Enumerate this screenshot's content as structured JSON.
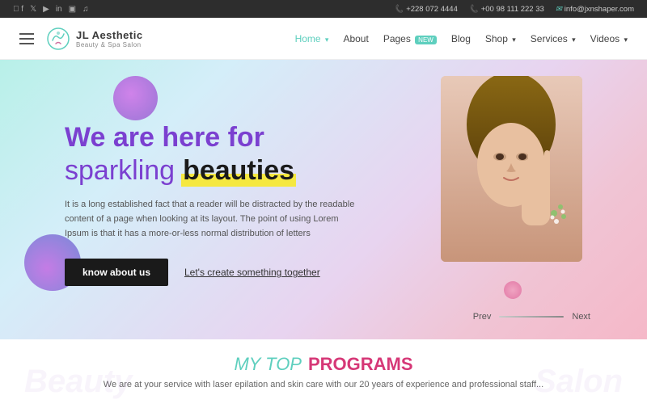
{
  "topbar": {
    "social_icons": [
      "facebook",
      "twitter",
      "youtube",
      "linkedin",
      "instagram",
      "tiktok"
    ],
    "phone1": "+228 072 4444",
    "phone2": "+00 98 111 222 33",
    "email": "info@jxnshaper.com"
  },
  "navbar": {
    "logo_title": "JL Aesthetic",
    "logo_sub": "Beauty & Spa Salon",
    "menu": [
      {
        "label": "Home",
        "active": true,
        "has_arrow": true,
        "badge": null
      },
      {
        "label": "About",
        "active": false,
        "has_arrow": false,
        "badge": null
      },
      {
        "label": "Pages",
        "active": false,
        "has_arrow": false,
        "badge": "NEW"
      },
      {
        "label": "Blog",
        "active": false,
        "has_arrow": false,
        "badge": null
      },
      {
        "label": "Shop",
        "active": false,
        "has_arrow": true,
        "badge": null
      },
      {
        "label": "Services",
        "active": false,
        "has_arrow": true,
        "badge": null
      },
      {
        "label": "Videos",
        "active": false,
        "has_arrow": true,
        "badge": null
      }
    ]
  },
  "hero": {
    "title_line1": "We are here for",
    "title_line2_normal": "sparkling",
    "title_line2_bold": "beauties",
    "description": "It is a long established fact that a reader will be distracted by the readable content of a page when looking at its layout. The point of using Lorem Ipsum is that it has a more-or-less normal distribution of letters",
    "btn_primary": "know about us",
    "btn_link": "Let's create something together",
    "prev_label": "Prev",
    "next_label": "Next"
  },
  "bottom": {
    "title_part1": "MY TOP",
    "title_part2": "PROGRAMS",
    "description": "We are at your service with laser epilation and skin care with our 20 years of experience and professional staff..."
  }
}
